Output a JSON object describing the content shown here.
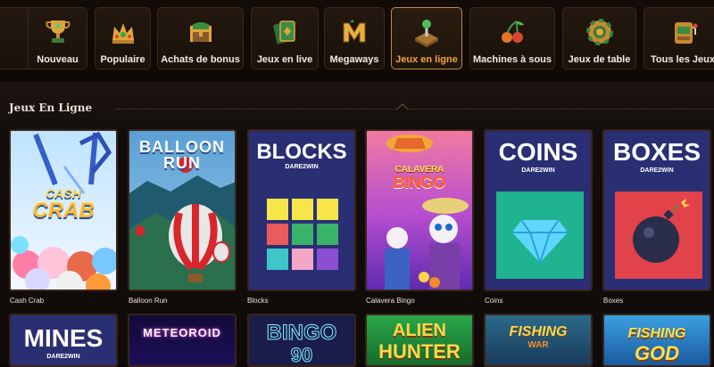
{
  "categories": [
    {
      "label": "Nouveau",
      "icon": "trophy-icon",
      "active": false
    },
    {
      "label": "Populaire",
      "icon": "crown-icon",
      "active": false
    },
    {
      "label": "Achats de bonus",
      "icon": "treasure-chest-icon",
      "active": false
    },
    {
      "label": "Jeux en live",
      "icon": "live-cards-icon",
      "active": false
    },
    {
      "label": "Megaways",
      "icon": "megaways-m-icon",
      "active": false
    },
    {
      "label": "Jeux en ligne",
      "icon": "joystick-icon",
      "active": true
    },
    {
      "label": "Machines à sous",
      "icon": "cherries-icon",
      "active": false
    },
    {
      "label": "Jeux de table",
      "icon": "casino-chip-icon",
      "active": false
    },
    {
      "label": "Tous les Jeux",
      "icon": "slot-machine-icon",
      "active": false
    }
  ],
  "section": {
    "title": "Jeux En Ligne"
  },
  "games": [
    {
      "name": "Cash Crab",
      "art_text": [
        "CASH",
        "CRAB"
      ]
    },
    {
      "name": "Balloon Run",
      "art_text": [
        "BALLOON",
        "RUN"
      ]
    },
    {
      "name": "Blocks",
      "art_text": [
        "BLOCKS",
        "DARE2WIN"
      ]
    },
    {
      "name": "Calavera Bingo",
      "art_text": [
        "CALAVERA",
        "BINGO"
      ]
    },
    {
      "name": "Coins",
      "art_text": [
        "COINS",
        "DARE2WIN"
      ]
    },
    {
      "name": "Boxes",
      "art_text": [
        "BOXES",
        "DARE2WIN"
      ]
    }
  ],
  "games_row2": [
    {
      "art_text": "MINES",
      "sub": "DARE2WIN"
    },
    {
      "art_text": "METEOROID"
    },
    {
      "art_text": "BINGO",
      "sub": "90"
    },
    {
      "art_text": "ALIEN",
      "sub": "HUNTER"
    },
    {
      "art_text": "FISHING",
      "sub": "WAR"
    },
    {
      "art_text": "FISHING",
      "sub": "GOD"
    }
  ],
  "colors": {
    "accent": "#f3a43b",
    "background": "#0d0806"
  }
}
